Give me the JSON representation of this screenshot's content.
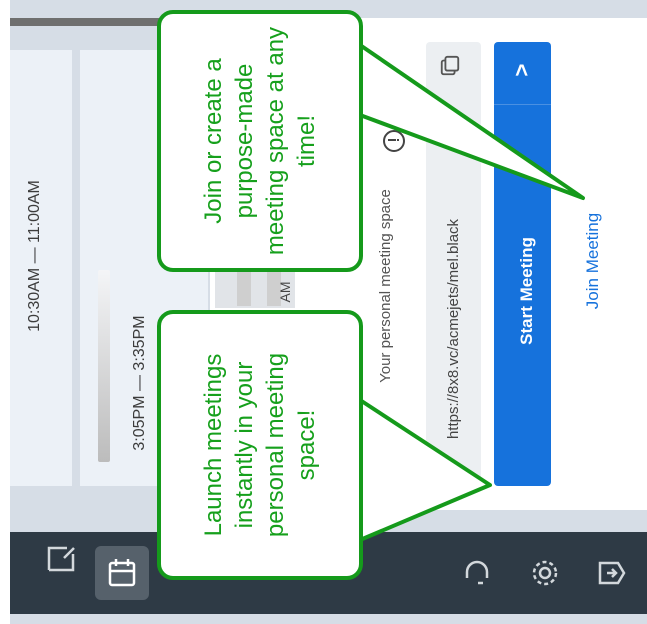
{
  "schedule": {
    "item1_time": "10:30AM — 11:00AM",
    "item2_time": "3:05PM — 3:35PM",
    "item3_fragment": "AM"
  },
  "meeting_panel": {
    "label": "Your personal meeting space",
    "url": "https://8x8.vc/acmejets/mel.black",
    "start_label": "Start Meeting",
    "expand_glyph": ">",
    "join_label": "Join Meeting"
  },
  "icons": {
    "info": "info-icon",
    "copy": "copy-icon",
    "compose": "compose-icon",
    "calendar": "calendar-icon",
    "headset": "headset-icon",
    "settings": "gear-icon",
    "exit": "exit-icon"
  },
  "callouts": {
    "top": "Join or create a purpose-made meeting space at any time!",
    "bottom": "Launch meetings instantly in your personal meeting space!"
  },
  "colors": {
    "accent_blue": "#1672dc",
    "callout_green": "#159a1b",
    "bottom_bar": "#2e3a45"
  }
}
